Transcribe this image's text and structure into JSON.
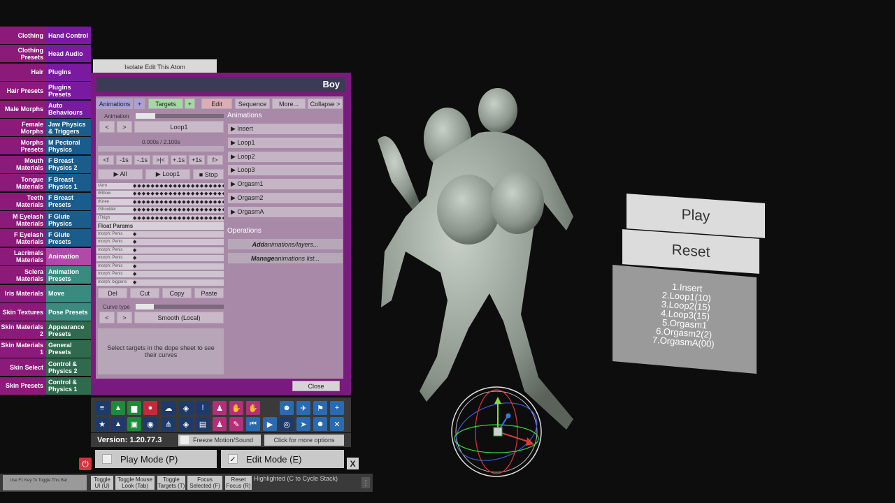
{
  "tabs": [
    {
      "left": "Clothing",
      "right": "Hand Control",
      "rc": ""
    },
    {
      "left": "Clothing Presets",
      "right": "Head Audio",
      "rc": ""
    },
    {
      "left": "Hair",
      "right": "Plugins",
      "rc": ""
    },
    {
      "left": "Hair Presets",
      "right": "Plugins Presets",
      "rc": ""
    },
    {
      "left": "Male Morphs",
      "right": "Auto Behaviours",
      "rc": ""
    },
    {
      "left": "Female Morphs",
      "right": "Jaw Physics & Triggers",
      "rc": "blue"
    },
    {
      "left": "Morphs Presets",
      "right": "M Pectoral Physics",
      "rc": "blue"
    },
    {
      "left": "Mouth Materials",
      "right": "F Breast Physics 2",
      "rc": "blue"
    },
    {
      "left": "Tongue Materials",
      "right": "F Breast Physics 1",
      "rc": "blue"
    },
    {
      "left": "Teeth Materials",
      "right": "F Breast Presets",
      "rc": "blue"
    },
    {
      "left": "M Eyelash Materials",
      "right": "F Glute Physics",
      "rc": "blue"
    },
    {
      "left": "F Eyelash Materials",
      "right": "F Glute Presets",
      "rc": "blue"
    },
    {
      "left": "Lacrimals Materials",
      "right": "Animation",
      "rc": "active"
    },
    {
      "left": "Sclera Materials",
      "right": "Animation Presets",
      "rc": "teal"
    },
    {
      "left": "Iris Materials",
      "right": "Move",
      "rc": "teal"
    },
    {
      "left": "Skin Textures",
      "right": "Pose Presets",
      "rc": "teal"
    },
    {
      "left": "Skin Materials 2",
      "right": "Appearance Presets",
      "rc": "green"
    },
    {
      "left": "Skin Materials 1",
      "right": "General Presets",
      "rc": "green"
    },
    {
      "left": "Skin Select",
      "right": "Control & Physics 2",
      "rc": "green"
    },
    {
      "left": "Skin Presets",
      "right": "Control & Physics 1",
      "rc": "green"
    }
  ],
  "isolate_button": "Isolate Edit This Atom",
  "atom_title": "Boy",
  "header_tabs": {
    "animations": "Animations",
    "plus1": "+",
    "targets": "Targets",
    "plus2": "+",
    "edit": "Edit",
    "sequence": "Sequence",
    "more": "More...",
    "collapse": "Collapse >"
  },
  "animation_label": "Animation",
  "prev": "<",
  "next": ">",
  "current_animation": "Loop1",
  "time_display": "0.000s / 2.100s",
  "scrub_buttons": [
    "<f",
    "-1s",
    "-.1s",
    ">|<",
    "+.1s",
    "+1s",
    "f>"
  ],
  "play_all": "▶ All",
  "play_loop": "▶ Loop1",
  "stop": "■ Stop",
  "dope_targets": [
    "rArm",
    "rElbow",
    "rKnee",
    "rShoulder",
    "rThigh"
  ],
  "float_params_label": "Float Params",
  "float_params": [
    "morph: Penis",
    "morph: Penis",
    "morph: Penis",
    "morph: Penis",
    "morph: Penis",
    "morph: Penis",
    "morph: bigpens"
  ],
  "clip_buttons": {
    "del": "Del",
    "cut": "Cut",
    "copy": "Copy",
    "paste": "Paste"
  },
  "curve_type_label": "Curve type",
  "curve_type": "Smooth (Local)",
  "help_text": "Select targets in the dope sheet to see their curves",
  "animations_title": "Animations",
  "animations_list": [
    "▶ Insert",
    "▶ Loop1",
    "▶ Loop2",
    "▶ Loop3",
    "▶ Orgasm1",
    "▶ Orgasm2",
    "▶ OrgasmA"
  ],
  "operations_title": "Operations",
  "op_add_em": "Add",
  "op_add_rest": " animations/layers...",
  "op_manage_em": "Manage",
  "op_manage_rest": " animations list...",
  "close": "Close",
  "version": "Version: 1.20.77.3",
  "freeze_motion": "Freeze Motion/Sound",
  "more_options": "Click for more options",
  "play_mode": "Play Mode (P)",
  "edit_mode": "Edit Mode (E)",
  "x_button": "X",
  "f1_hint": "Use F1 Key To Toggle This Bar",
  "bottom_buttons": [
    {
      "l1": "Toggle",
      "l2": "UI (U)"
    },
    {
      "l1": "Toggle Mouse",
      "l2": "Look (Tab)"
    },
    {
      "l1": "Toggle",
      "l2": "Targets (T)"
    },
    {
      "l1": "Focus",
      "l2": "Selected (F)"
    },
    {
      "l1": "Reset",
      "l2": "Focus (R)"
    }
  ],
  "highlighted_text": "Highlighted (C to Cycle Stack)",
  "scene": {
    "play": "Play",
    "reset": "Reset",
    "list": [
      "1.Insert",
      "2.Loop1(10)",
      "3.Loop2(15)",
      "4.Loop3(15)",
      "5.Orgasm1",
      "6.Orgasm2(2)",
      "7.OrgasmA(00)"
    ]
  }
}
